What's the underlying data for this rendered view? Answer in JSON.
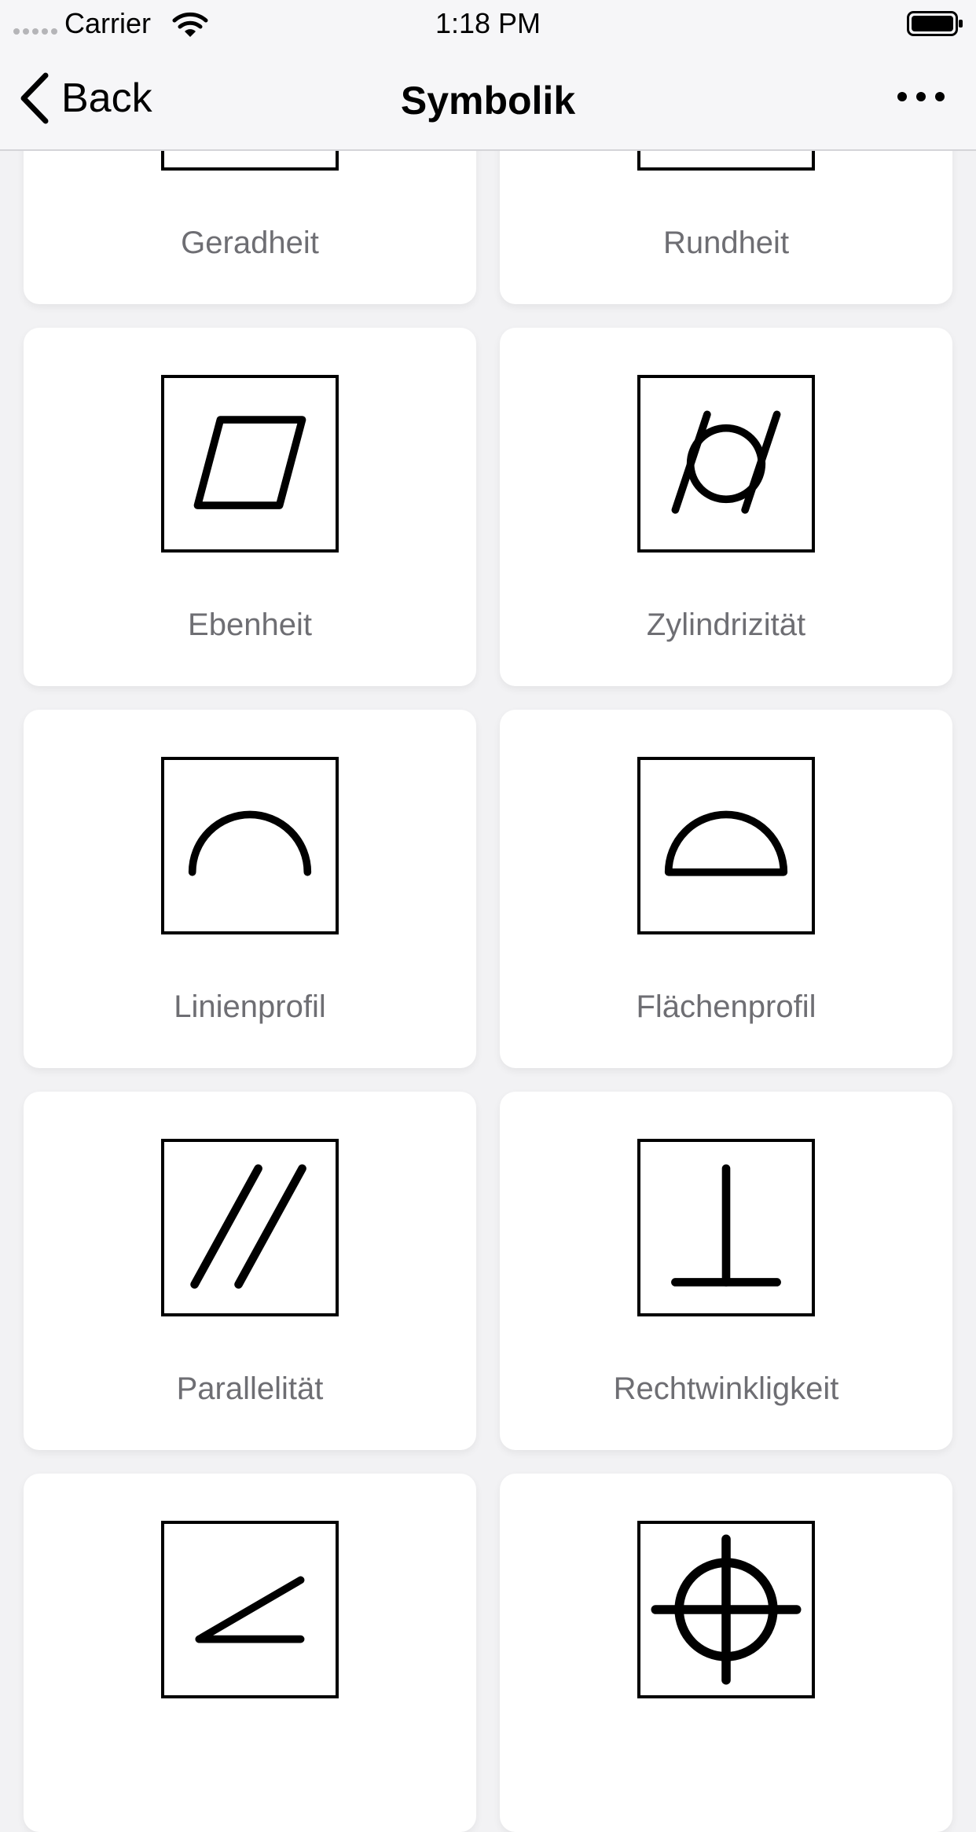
{
  "status_bar": {
    "carrier": "Carrier",
    "time": "1:18 PM"
  },
  "nav": {
    "back_label": "Back",
    "title": "Symbolik"
  },
  "symbols": [
    {
      "label": "Geradheit",
      "icon": "straightness-icon"
    },
    {
      "label": "Rundheit",
      "icon": "circularity-icon"
    },
    {
      "label": "Ebenheit",
      "icon": "flatness-icon"
    },
    {
      "label": "Zylindrizität",
      "icon": "cylindricity-icon"
    },
    {
      "label": "Linienprofil",
      "icon": "line-profile-icon"
    },
    {
      "label": "Flächenprofil",
      "icon": "surface-profile-icon"
    },
    {
      "label": "Parallelität",
      "icon": "parallelism-icon"
    },
    {
      "label": "Rechtwinkligkeit",
      "icon": "perpendicularity-icon"
    },
    {
      "label": "",
      "icon": "angularity-icon"
    },
    {
      "label": "",
      "icon": "position-icon"
    }
  ]
}
